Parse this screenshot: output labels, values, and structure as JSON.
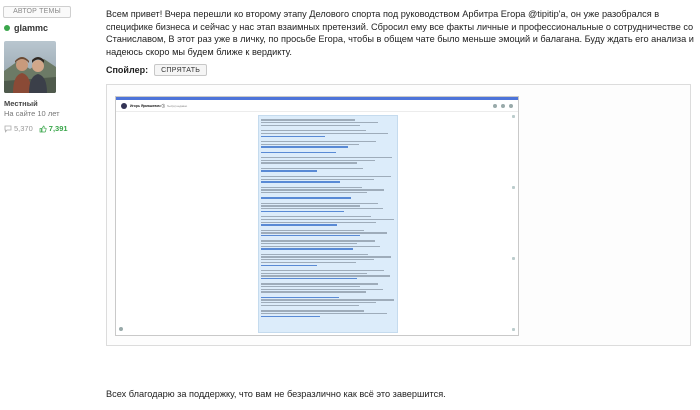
{
  "author": {
    "badge": "АВТОР ТЕМЫ",
    "name": "glammc",
    "rank": "Местный",
    "since": "На сайте 10 лет",
    "messages": "5,370",
    "rating": "7,391",
    "colors": {
      "online": "#3aa64b",
      "rating": "#3aa64b"
    }
  },
  "post": {
    "text": "Всем привет! Вчера перешли ко второму этапу Делового спорта под руководством Арбитра Егора @tipitip'а, он уже разобрался в специфике бизнеса и сейчас у нас этап взаимных претензий. Сбросил ему все факты личные и профессиональные о сотрудничестве со Станиславом,  В этот раз уже в личку, по просьбе Егора, чтобы в общем чате было меньше эмоций и балагана. Буду ждать его анализа и надеюсь скоро мы будем ближе к вердикту.",
    "spoiler_label": "Спойлер:",
    "spoiler_button": "СПРЯТАТЬ",
    "screenshot": {
      "chat_name": "Игорь Ярмашевич ⓘ",
      "chat_status": "был(а) недавно"
    },
    "thanks": "Всех благодарю за поддержку, что вам не безразлично как всё это завершится."
  }
}
